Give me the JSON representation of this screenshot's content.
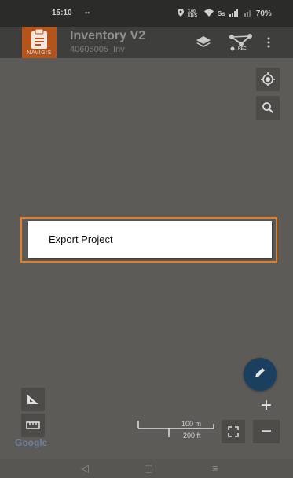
{
  "status_bar": {
    "time": "15:10",
    "notification_dots": "••",
    "network_label": "3.00 KB/S",
    "sim_label": "Ss",
    "battery": "70%"
  },
  "app_bar": {
    "logo_caption": "NAVIGIS",
    "title": "Inventory V2",
    "subtitle": "40605005_Inv",
    "icons": [
      "layers-icon",
      "network-rec-icon",
      "more-vert-icon"
    ],
    "rec_label": "REC"
  },
  "map": {
    "background_color": "#5c5b58",
    "top_controls": [
      "my-location-icon",
      "search-icon"
    ],
    "left_controls": [
      "angle-measure-icon",
      "ruler-icon"
    ],
    "scale": {
      "metric": "100 m",
      "imperial": "200 ft"
    },
    "attribution": "Google"
  },
  "dialog": {
    "item": "Export Project",
    "highlight_color": "#e57f22"
  },
  "fab": {
    "icon": "edit-pencil-icon",
    "color": "#1b3f5f"
  },
  "zoom": {
    "in_label": "+",
    "out_label": "−"
  },
  "nav_bar": {
    "back": "◁",
    "home": "▢",
    "recents": "≡"
  },
  "colors": {
    "brand": "#b3541c",
    "appbar": "#3e3e3c"
  }
}
